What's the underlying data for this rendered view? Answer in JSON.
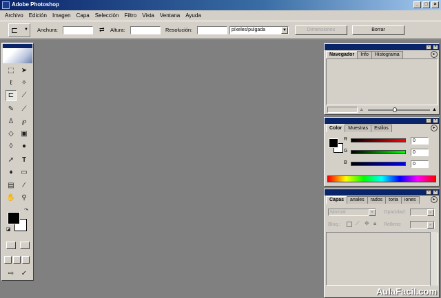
{
  "window": {
    "title": "Adobe Photoshop",
    "controls": [
      "_",
      "□",
      "×"
    ]
  },
  "menu": [
    "Archivo",
    "Edición",
    "Imagen",
    "Capa",
    "Selección",
    "Filtro",
    "Vista",
    "Ventana",
    "Ayuda"
  ],
  "options": {
    "width_label": "Anchura:",
    "swap_icon": "⇄",
    "height_label": "Altura:",
    "resolution_label": "Resolución:",
    "resolution_unit": "píxeles/pulgada",
    "front_image_button": "Dimensiones",
    "clear_button": "Borrar"
  },
  "toolbox": {
    "tools": [
      "marquee-icon",
      "move-icon",
      "lasso-icon",
      "magic-wand-icon",
      "crop-icon",
      "slice-icon",
      "healing-brush-icon",
      "brush-icon",
      "clone-stamp-icon",
      "history-brush-icon",
      "eraser-icon",
      "gradient-icon",
      "blur-icon",
      "dodge-icon",
      "path-selection-icon",
      "type-icon",
      "pen-icon",
      "shape-icon",
      "notes-icon",
      "eyedropper-icon",
      "hand-icon",
      "zoom-icon"
    ],
    "foreground_color": "#000000",
    "background_color": "#ffffff"
  },
  "navigator_panel": {
    "tabs": [
      "Navegador",
      "Info",
      "Histograma"
    ]
  },
  "color_panel": {
    "tabs": [
      "Color",
      "Muestras",
      "Estilos"
    ],
    "sliders": [
      {
        "label": "R",
        "value": "0",
        "gradient": "linear-gradient(to right,#000,#f00)"
      },
      {
        "label": "G",
        "value": "0",
        "gradient": "linear-gradient(to right,#000,#0f0)"
      },
      {
        "label": "B",
        "value": "0",
        "gradient": "linear-gradient(to right,#000,#00f)"
      }
    ]
  },
  "layers_panel": {
    "tabs": [
      "Capas",
      "anales",
      "rados",
      "toria",
      "iones"
    ],
    "blend_mode": "Normal",
    "opacity_label": "Opacidad:",
    "lock_label": "Bloq.:",
    "fill_label": "Relleno:"
  },
  "watermark": "AulaFacil.com"
}
